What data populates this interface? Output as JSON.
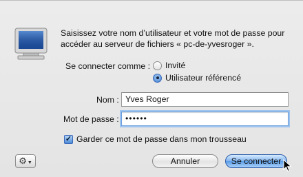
{
  "message": "Saisissez votre nom d’utilisateur et votre mot de passe pour accéder au serveur de fichiers « pc-de-yvesroger ».",
  "connect_as": {
    "label": "Se connecter comme :",
    "options": [
      {
        "label": "Invité",
        "selected": false
      },
      {
        "label": "Utilisateur référencé",
        "selected": true
      }
    ]
  },
  "name_field": {
    "label": "Nom :",
    "value": "Yves Roger"
  },
  "password_field": {
    "label": "Mot de passe :",
    "value": "••••••"
  },
  "keychain_checkbox": {
    "label": "Garder ce mot de passe dans mon trousseau",
    "checked": true
  },
  "buttons": {
    "actions_icon": "gear-icon",
    "cancel": "Annuler",
    "connect": "Se connecter"
  },
  "colors": {
    "accent": "#5a9de8",
    "focus_ring": "#9ec3ee",
    "background": "#e9e9e9"
  }
}
